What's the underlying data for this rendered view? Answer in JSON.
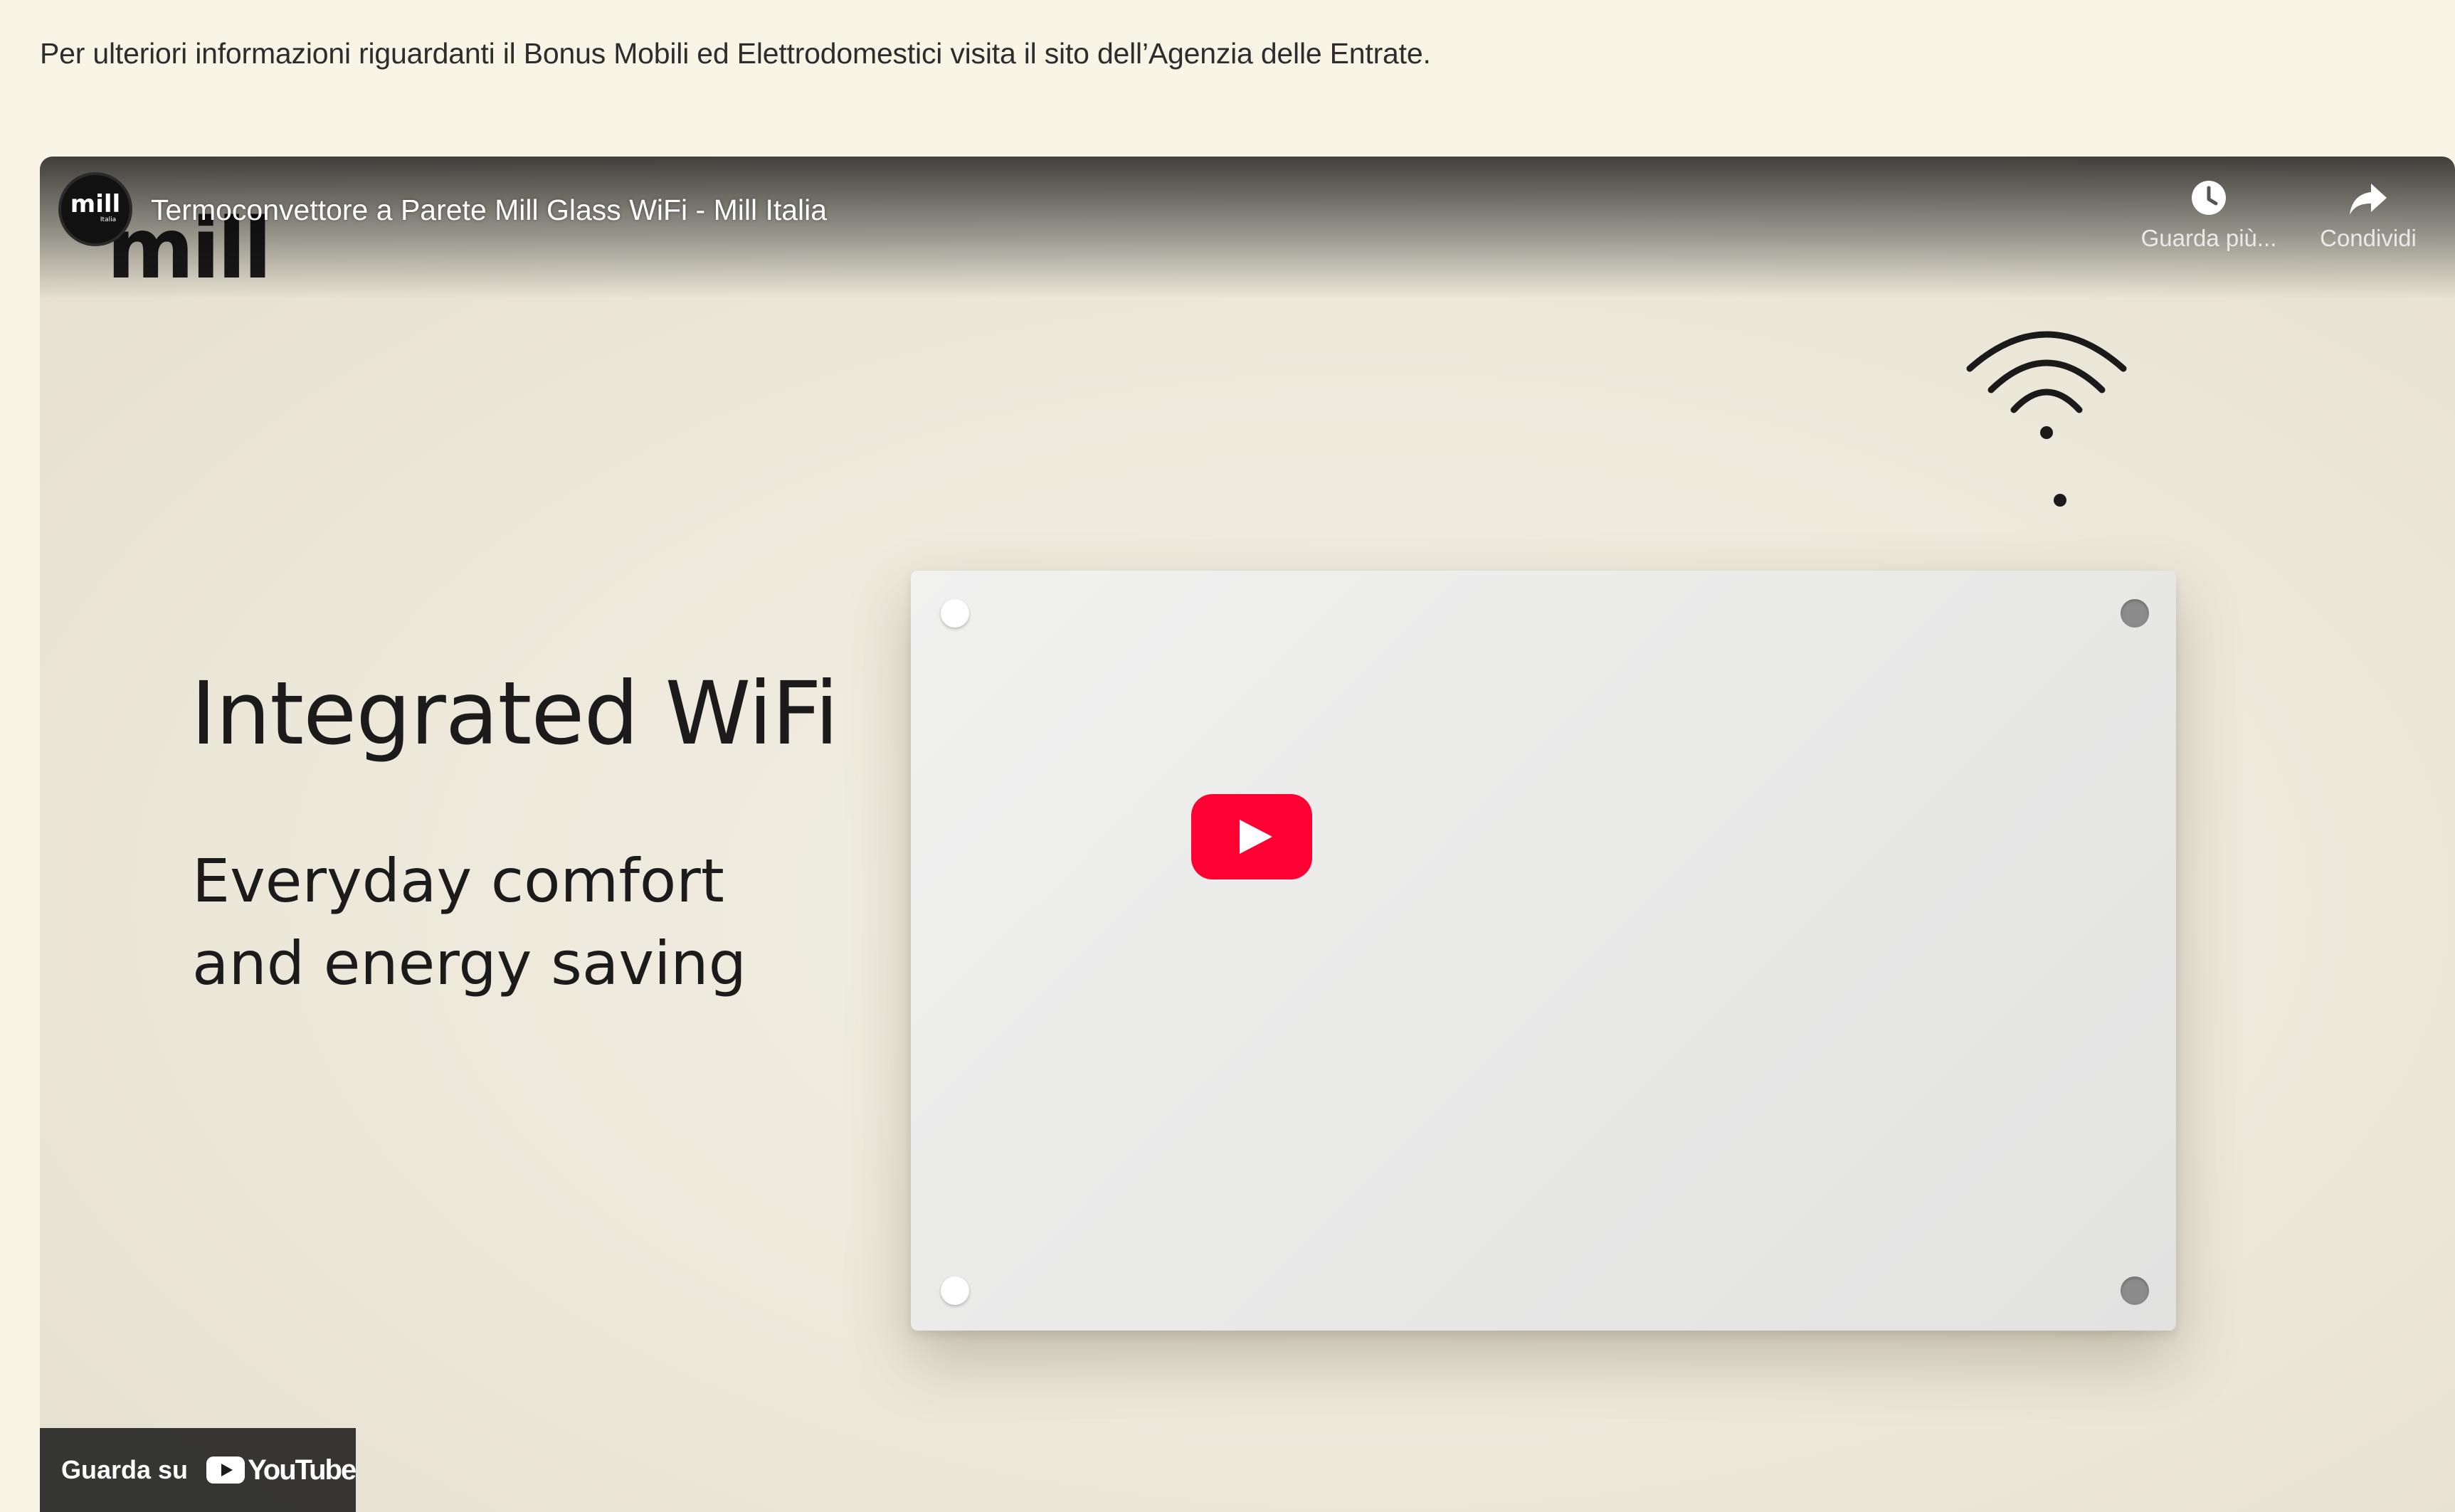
{
  "article": {
    "info_text": "Per ulteriori informazioni riguardanti il Bonus Mobili ed Elettrodomestici visita il sito dell’Agenzia delle Entrate."
  },
  "video": {
    "title": "Termoconvettore a Parete Mill Glass WiFi - Mill Italia",
    "channel_avatar": {
      "main": "mill",
      "sub": "Italia"
    },
    "brand_logo": "mill",
    "actions": {
      "watch_later": {
        "label": "Guarda più...",
        "icon": "clock-icon"
      },
      "share": {
        "label": "Condividi",
        "icon": "share-arrow-icon"
      }
    },
    "thumbnail": {
      "heading": "Integrated WiFi",
      "subheading": [
        "Everyday comfort",
        "and energy saving"
      ],
      "wifi_icon": "wifi-icon"
    },
    "play_button": {
      "icon": "youtube-play-icon",
      "color": "#ff0033"
    },
    "watch_on": {
      "label": "Guarda su",
      "brand": "YouTube"
    }
  }
}
